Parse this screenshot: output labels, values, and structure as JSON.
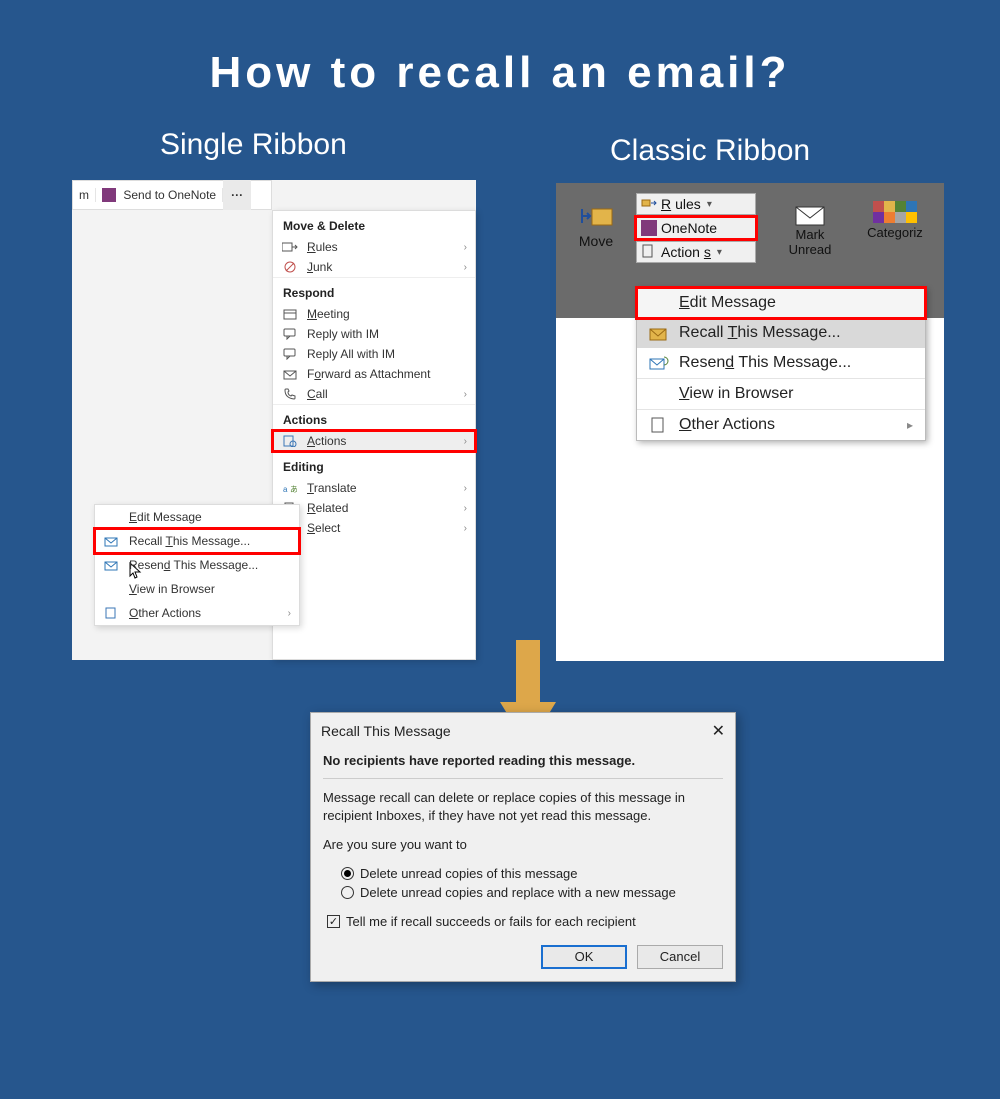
{
  "title": "How to recall an email?",
  "labels": {
    "single": "Single Ribbon",
    "classic": "Classic Ribbon"
  },
  "single_ribbon": {
    "toolbar": {
      "fragment": "m",
      "send_to_onenote": "Send to OneNote",
      "more": "···"
    },
    "headers": {
      "move_delete": "Move & Delete",
      "respond": "Respond",
      "actions_hdr": "Actions",
      "editing": "Editing"
    },
    "items": {
      "rules": "Rules",
      "junk": "Junk",
      "meeting": "Meeting",
      "reply_im": "Reply with IM",
      "reply_all_im": "Reply All with IM",
      "forward_attach": "Forward as Attachment",
      "call": "Call",
      "actions": "Actions",
      "translate": "Translate",
      "related": "Related",
      "select": "Select"
    },
    "submenu": {
      "edit": "Edit Message",
      "recall": "Recall This Message...",
      "resend": "Resend This Message...",
      "view": "View in Browser",
      "other": "Other Actions"
    }
  },
  "classic_ribbon": {
    "buttons": {
      "move": "Move",
      "rules": "Rules",
      "onenote": "OneNote",
      "actions": "Actions",
      "mark": "Mark",
      "unread": "Unread",
      "categorize": "Categoriz"
    },
    "menu": {
      "edit": "Edit Message",
      "recall": "Recall This Message...",
      "resend": "Resend This Message...",
      "view": "View in Browser",
      "other": "Other Actions"
    }
  },
  "dialog": {
    "title": "Recall This Message",
    "bold": "No recipients have reported reading this message.",
    "para": "Message recall can delete or replace copies of this message in recipient Inboxes, if they have not yet read this message.",
    "prompt": "Are you sure you want to",
    "opt1": "Delete unread copies of this message",
    "opt2": "Delete unread copies and replace with a new message",
    "check": "Tell me if recall succeeds or fails for each recipient",
    "ok": "OK",
    "cancel": "Cancel"
  }
}
